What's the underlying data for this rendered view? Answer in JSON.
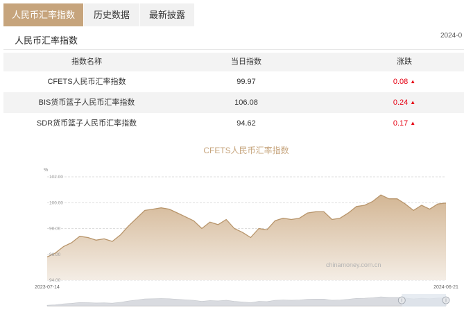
{
  "tabs": [
    {
      "label": "人民币汇率指数",
      "active": true
    },
    {
      "label": "历史数据",
      "active": false
    },
    {
      "label": "最新披露",
      "active": false
    }
  ],
  "section": {
    "title": "人民币汇率指数",
    "date": "2024-0"
  },
  "table": {
    "headers": [
      "指数名称",
      "当日指数",
      "涨跌"
    ],
    "rows": [
      {
        "name": "CFETS人民币汇率指数",
        "value": "99.97",
        "change": "0.08",
        "arrow": "▲"
      },
      {
        "name": "BIS货币篮子人民币汇率指数",
        "value": "106.08",
        "change": "0.24",
        "arrow": "▲"
      },
      {
        "name": "SDR货币篮子人民币汇率指数",
        "value": "94.62",
        "change": "0.17",
        "arrow": "▲"
      }
    ]
  },
  "colors": {
    "accent": "#c6a47c",
    "up": "#e60012",
    "line": "#b8956b",
    "area_top": "#d3b694",
    "area_bottom": "#f4ede5",
    "navigator_fill": "#d9dbe0",
    "navigator_window": "#dfe5ee"
  },
  "chart_data": {
    "type": "area",
    "title": "CFETS人民币汇率指数",
    "ylabel": "%",
    "xlabel": "",
    "ylim": [
      94,
      102
    ],
    "yticks": [
      "94.00",
      "96.00",
      "98.00",
      "100.00",
      "102.00"
    ],
    "xtick_labels": [
      "2023-07-14",
      "2024-06-21"
    ],
    "grid": true,
    "legend": "none",
    "watermark": "chinamoney.com.cn",
    "x": [
      "2023-07-14",
      "2023-07-21",
      "2023-07-28",
      "2023-08-04",
      "2023-08-11",
      "2023-08-18",
      "2023-08-25",
      "2023-09-01",
      "2023-09-08",
      "2023-09-15",
      "2023-09-22",
      "2023-09-29",
      "2023-10-06",
      "2023-10-13",
      "2023-10-20",
      "2023-10-27",
      "2023-11-03",
      "2023-11-10",
      "2023-11-17",
      "2023-11-24",
      "2023-12-01",
      "2023-12-08",
      "2023-12-15",
      "2023-12-22",
      "2023-12-29",
      "2024-01-05",
      "2024-01-12",
      "2024-01-19",
      "2024-01-26",
      "2024-02-02",
      "2024-02-09",
      "2024-02-16",
      "2024-02-23",
      "2024-03-01",
      "2024-03-08",
      "2024-03-15",
      "2024-03-22",
      "2024-03-29",
      "2024-04-05",
      "2024-04-12",
      "2024-04-19",
      "2024-04-26",
      "2024-05-03",
      "2024-05-10",
      "2024-05-17",
      "2024-05-24",
      "2024-05-31",
      "2024-06-07",
      "2024-06-14",
      "2024-06-21"
    ],
    "values": [
      95.8,
      96.1,
      96.6,
      96.9,
      97.4,
      97.3,
      97.1,
      97.2,
      97.0,
      97.5,
      98.2,
      98.8,
      99.4,
      99.5,
      99.6,
      99.5,
      99.2,
      98.9,
      98.6,
      98.0,
      98.5,
      98.3,
      98.7,
      98.0,
      97.7,
      97.3,
      98.0,
      97.9,
      98.6,
      98.8,
      98.7,
      98.8,
      99.2,
      99.3,
      99.3,
      98.7,
      98.8,
      99.2,
      99.7,
      99.8,
      100.1,
      100.6,
      100.3,
      100.3,
      99.9,
      99.4,
      99.8,
      99.5,
      99.9,
      99.97
    ],
    "navigator_window": [
      "2024-05-14",
      "2024-06-21"
    ]
  }
}
